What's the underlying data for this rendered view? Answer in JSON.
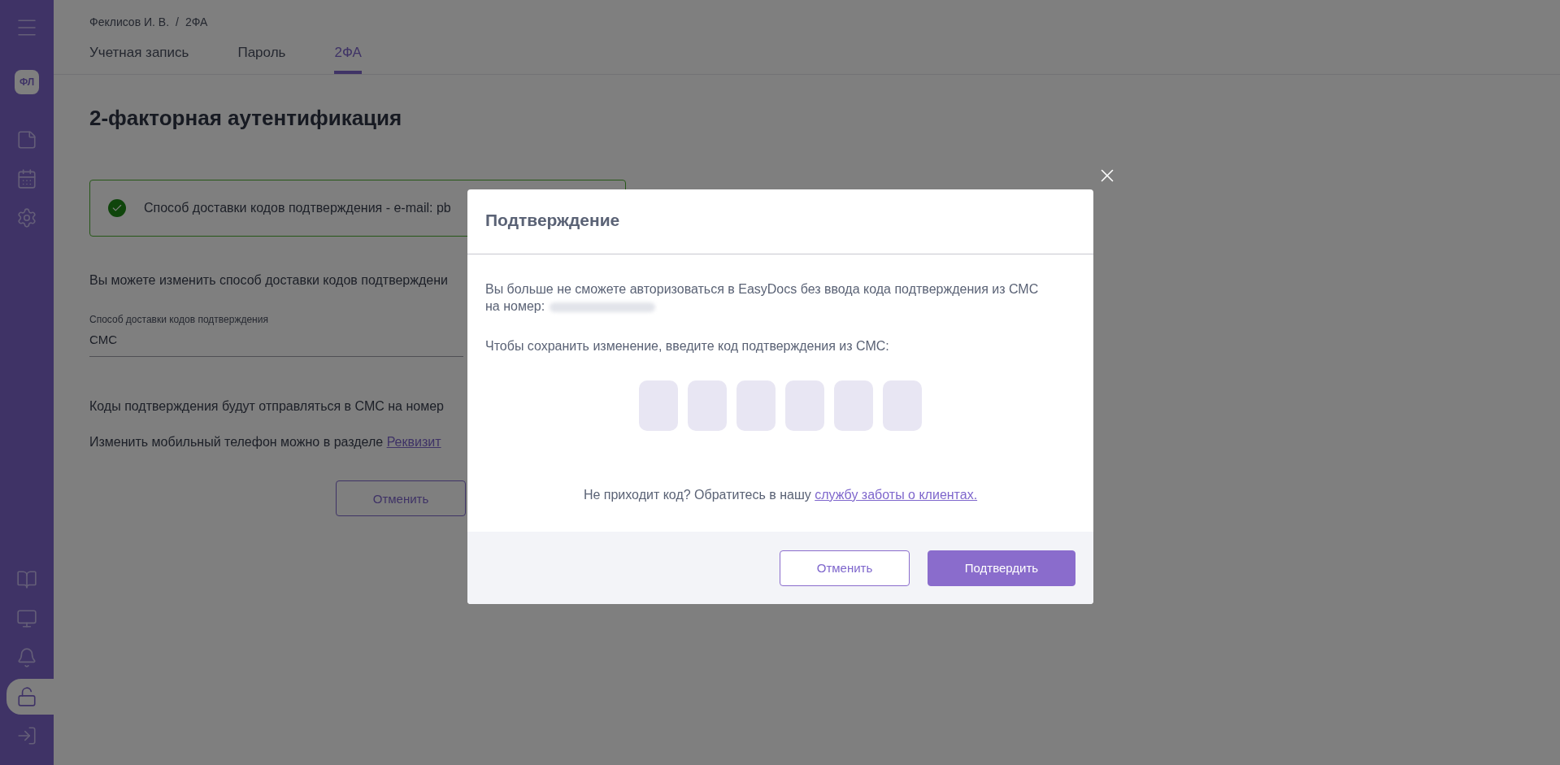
{
  "sidebar": {
    "avatar": "ФЛ",
    "top_items": [
      {
        "selected": false
      },
      {
        "selected": false
      },
      {
        "selected": false
      }
    ],
    "bottom_items": [
      {
        "selected": false
      },
      {
        "selected": false
      },
      {
        "selected": false
      },
      {
        "selected": true
      },
      {
        "selected": false
      }
    ]
  },
  "breadcrumb": [
    "Феклисов И. В.",
    "/",
    "2ФА"
  ],
  "tabs": [
    {
      "label": "Учетная запись",
      "selected": false
    },
    {
      "label": "Пароль",
      "selected": false
    },
    {
      "label": "2ФА",
      "selected": true
    }
  ],
  "page": {
    "title": "2-факторная аутентификация",
    "notice": {
      "kind": "success",
      "text": "Способ доставки кодов подтверждения - e-mail: pb"
    },
    "intro": "Вы можете изменить способ доставки кодов подтверждени",
    "field": {
      "label": "Способ доставки кодов подтверждения",
      "value": "СМС"
    },
    "sms_note": "Коды подтверждения будут отправляться в СМС на номер",
    "phone_note": {
      "text": "Изменить мобильный телефон можно в разделе ",
      "link": "Реквизит"
    },
    "cancel": "Отменить"
  },
  "modal": {
    "title": "Подтверждение",
    "message": [
      "Вы больше не сможете авторизоваться в EasyDocs без ввода кода подтверждения из СМС",
      "на номер:"
    ],
    "prompt": "Чтобы сохранить изменение, введите код подтверждения из СМС:",
    "code_fields": [
      {
        "kind": "digit"
      },
      {
        "kind": "digit"
      },
      {
        "kind": "digit"
      },
      {
        "kind": "digit"
      },
      {
        "kind": "digit"
      },
      {
        "kind": "digit"
      }
    ],
    "help": {
      "text": "Не приходит код? Обратитесь в нашу ",
      "link": "службу заботы о клиентах."
    },
    "buttons": [
      {
        "label": "Отменить",
        "kind": "secondary"
      },
      {
        "label": "Подтвердить",
        "kind": "primary"
      }
    ]
  }
}
